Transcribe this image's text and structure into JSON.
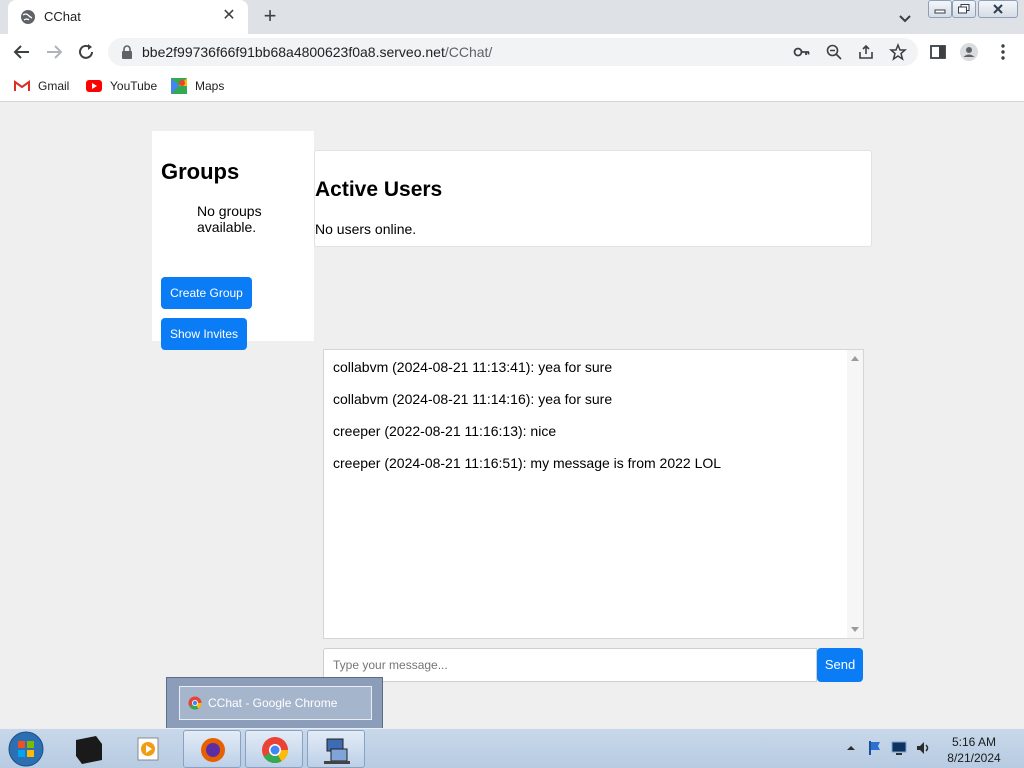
{
  "browser": {
    "tab_title": "CChat",
    "url_host": "bbe2f99736f66f91bb68a4800623f0a8.serveo.net",
    "url_path": "/CChat/",
    "bookmarks": [
      {
        "label": "Gmail",
        "icon": "gmail-icon"
      },
      {
        "label": "YouTube",
        "icon": "youtube-icon"
      },
      {
        "label": "Maps",
        "icon": "maps-icon"
      }
    ]
  },
  "groups": {
    "title": "Groups",
    "empty_text": "No groups available.",
    "create_button": "Create Group",
    "invites_button": "Show Invites"
  },
  "active_users": {
    "title": "Active Users",
    "status": "No users online."
  },
  "messages": [
    {
      "text": "collabvm (2024-08-21 11:13:41): yea for sure"
    },
    {
      "text": "collabvm (2024-08-21 11:14:16): yea for sure"
    },
    {
      "text": "creeper (2022-08-21 11:16:13): nice"
    },
    {
      "text": "creeper (2024-08-21 11:16:51): my message is from 2022 LOL"
    }
  ],
  "composer": {
    "placeholder": "Type your message...",
    "send_label": "Send"
  },
  "taskbar": {
    "preview_title": "CChat - Google Chrome",
    "time": "5:16 AM",
    "date": "8/21/2024"
  },
  "colors": {
    "accent": "#0a7cf5",
    "page_bg": "#efefef"
  }
}
